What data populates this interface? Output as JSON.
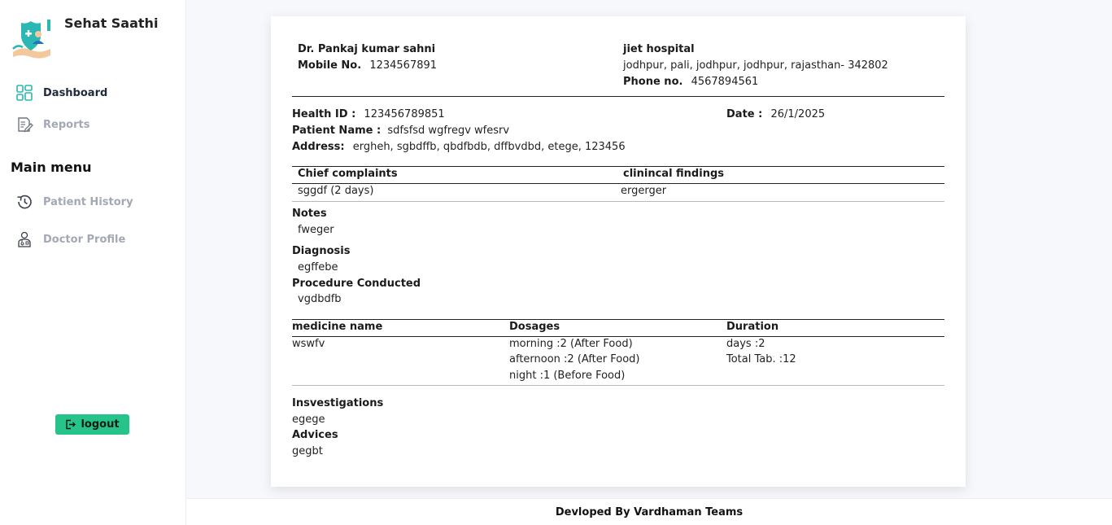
{
  "app": {
    "name": "Sehat Saathi"
  },
  "nav": {
    "dashboard": "Dashboard",
    "reports": "Reports",
    "section_title": "Main menu",
    "patient_history": "Patient History",
    "doctor_profile": "Doctor Profile",
    "logout": "logout"
  },
  "doctor": {
    "name": "Dr.  Pankaj kumar sahni",
    "mobile_label": "Mobile No.",
    "mobile": "1234567891"
  },
  "hospital": {
    "name": "jiet hospital",
    "address": "jodhpur, pali, jodhpur, jodhpur, rajasthan- 342802",
    "phone_label": "Phone no.",
    "phone": "4567894561"
  },
  "patient": {
    "health_id_label": "Health ID :",
    "health_id": "123456789851",
    "date_label": "Date :",
    "date": "26/1/2025",
    "name_label": "Patient Name :",
    "name": "sdfsfsd wgfregv wfesrv",
    "address_label": "Address:",
    "address": "ergheh, sgbdffb, qbdfbdb, dffbvdbd, etege, 123456"
  },
  "complaints": {
    "col1": "Chief complaints",
    "col2": "clinincal findings",
    "val1": "sggdf (2 days)",
    "val2": "ergerger"
  },
  "notes": {
    "label": "Notes",
    "value": "fweger"
  },
  "diagnosis": {
    "label": "Diagnosis",
    "value": "egffebe"
  },
  "procedure": {
    "label": "Procedure Conducted",
    "value": "vgdbdfb"
  },
  "medicine": {
    "headers": [
      "medicine name",
      "Dosages",
      "Duration"
    ],
    "rows": [
      {
        "name": "wswfv",
        "dosages": [
          "morning :2 (After Food)",
          "afternoon :2 (After Food)",
          "night :1 (Before Food)"
        ],
        "duration": [
          "days :2",
          "Total Tab. :12"
        ]
      }
    ]
  },
  "investigations": {
    "label": "Insvestigations",
    "value": "egege"
  },
  "advices": {
    "label": "Advices",
    "value": "gegbt"
  },
  "footer": {
    "text": "Devloped By Vardhaman Teams"
  },
  "colors": {
    "accent": "#26c48a",
    "icon_teal": "#2bb7b3",
    "muted": "#a3a8b3"
  }
}
